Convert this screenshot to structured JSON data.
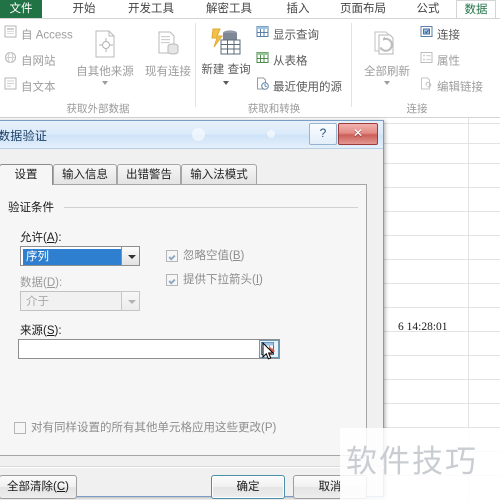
{
  "app": {
    "ribbon_tabs": [
      {
        "label": "文件",
        "active": false,
        "kind": "file"
      },
      {
        "label": "开始",
        "active": false
      },
      {
        "label": "开发工具",
        "active": false
      },
      {
        "label": "解密工具",
        "active": false
      },
      {
        "label": "插入",
        "active": false
      },
      {
        "label": "页面布局",
        "active": false
      },
      {
        "label": "公式",
        "active": false
      },
      {
        "label": "数据",
        "active": true
      }
    ],
    "ribbon_groups": [
      {
        "label": "获取外部数据",
        "small_items": [
          "自 Access",
          "自网站",
          "自文本"
        ],
        "big_items": [
          "自其他来源",
          "现有连接"
        ]
      },
      {
        "label": "获取和转换",
        "big_items": [
          "新建\n查询"
        ],
        "small_items": [
          "显示查询",
          "从表格",
          "最近使用的源"
        ]
      },
      {
        "label": "连接",
        "big_items": [
          "全部刷新"
        ],
        "small_items": [
          "连接",
          "属性",
          "编辑链接"
        ]
      }
    ],
    "ribbon_labels": {
      "from_access": "自 Access",
      "from_web": "自网站",
      "from_text": "自文本",
      "from_other_sources": "自其他来源",
      "existing_connections": "现有连接",
      "new_query_line1": "新建",
      "new_query_line2": "查询",
      "show_queries": "显示查询",
      "from_table": "从表格",
      "recent_sources": "最近使用的源",
      "refresh_all_line1": "全部刷新",
      "connections": "连接",
      "properties": "属性",
      "edit_links": "编辑链接",
      "group_external_data": "获取外部数据",
      "group_get_transform": "获取和转换",
      "group_connections": "连接"
    }
  },
  "sheet": {
    "visible_cell_value": "6 14:28:01"
  },
  "dialog": {
    "title": "数据验证",
    "help_button": "?",
    "close_button": "✕",
    "tabs": [
      {
        "label": "设置",
        "selected": true
      },
      {
        "label": "输入信息",
        "selected": false
      },
      {
        "label": "出错警告",
        "selected": false
      },
      {
        "label": "输入法模式",
        "selected": false
      }
    ],
    "groupbox_title": "验证条件",
    "allow": {
      "label": "允许(A)",
      "label_plain": "允许",
      "accel": "A",
      "value": "序列",
      "selected": true
    },
    "data": {
      "label": "数据(D)",
      "label_plain": "数据",
      "accel": "D",
      "value": "介于",
      "disabled": true
    },
    "source": {
      "label": "来源(S)",
      "label_plain": "来源",
      "accel": "S",
      "value": "",
      "placeholder": "",
      "picker_icon": "range-select-icon"
    },
    "checkboxes": [
      {
        "label_plain": "忽略空值",
        "accel": "B",
        "checked": true,
        "dim": true
      },
      {
        "label_plain": "提供下拉箭头",
        "accel": "I",
        "checked": true,
        "dim": true
      }
    ],
    "apply_all": {
      "label_plain": "对有同样设置的所有其他单元格应用这些更改",
      "accel": "P",
      "checked": false,
      "dim": true
    },
    "buttons": {
      "clear_all_plain": "全部清除",
      "clear_all_accel": "C",
      "ok": "确定",
      "cancel": "取消"
    }
  },
  "watermark": {
    "text": "软件技巧"
  },
  "colors": {
    "excel_green": "#217346",
    "active_tab_text": "#217346",
    "selection_blue": "#2f7fd1",
    "dialog_border": "#7b9cc4",
    "close_red": "#cc5f58",
    "watermark_gray": "#c9cdd2"
  }
}
